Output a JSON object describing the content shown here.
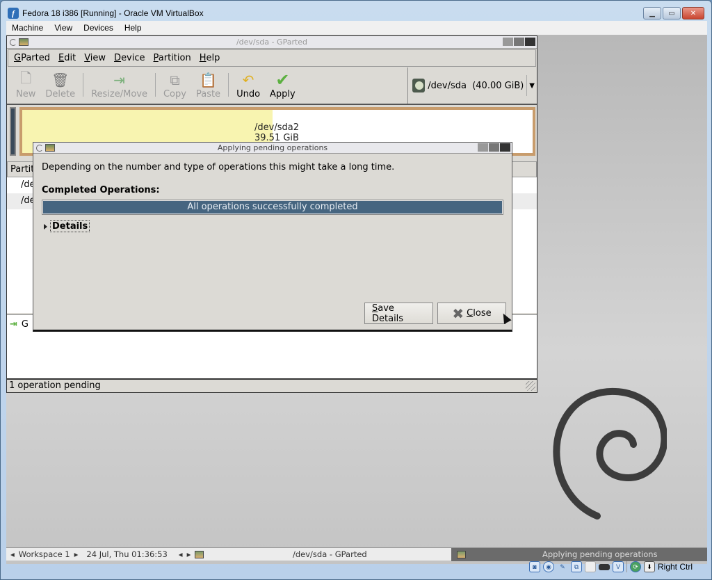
{
  "vbox": {
    "title": "Fedora 18 i386 [Running] - Oracle VM VirtualBox",
    "menu": [
      "Machine",
      "View",
      "Devices",
      "Help"
    ],
    "host_key": "Right Ctrl",
    "status_icons": [
      "hard-disk-icon",
      "optical-drive-icon",
      "usb-icon",
      "network-icon",
      "shared-folder-icon",
      "video-capture-icon",
      "virtualization-icon",
      "mouse-integration-icon",
      "host-key-icon"
    ]
  },
  "gparted": {
    "title": "/dev/sda - GParted",
    "menu": [
      {
        "label": "GParted",
        "u": "G",
        "rest": "Parted"
      },
      {
        "label": "Edit",
        "u": "E",
        "rest": "dit"
      },
      {
        "label": "View",
        "u": "V",
        "rest": "iew"
      },
      {
        "label": "Device",
        "u": "D",
        "rest": "evice"
      },
      {
        "label": "Partition",
        "u": "P",
        "rest": "artition"
      },
      {
        "label": "Help",
        "u": "H",
        "rest": "elp"
      }
    ],
    "toolbar": {
      "new": "New",
      "delete": "Delete",
      "resize": "Resize/Move",
      "copy": "Copy",
      "paste": "Paste",
      "undo": "Undo",
      "apply": "Apply"
    },
    "device": "/dev/sda  (40.00 GiB)",
    "partition_map": {
      "name": "/dev/sda2",
      "size": "39.51 GiB",
      "used_fraction": 0.49
    },
    "table_header": "Partit",
    "rows": [
      "/de",
      "/de"
    ],
    "pending_op": "G",
    "status": "1 operation pending"
  },
  "dialog": {
    "title": "Applying pending operations",
    "message": "Depending on the number and type of operations this might take a long time.",
    "completed_label": "Completed Operations:",
    "progress_text": "All operations successfully completed",
    "progress": 1.0,
    "details": "Details",
    "save_u": "S",
    "save_rest": "ave Details",
    "close_u": "C",
    "close_rest": "lose"
  },
  "taskbar": {
    "workspace": "Workspace 1",
    "datetime": "24 Jul, Thu 01:36:53",
    "task1": "/dev/sda - GParted",
    "task2": "Applying pending operations"
  }
}
